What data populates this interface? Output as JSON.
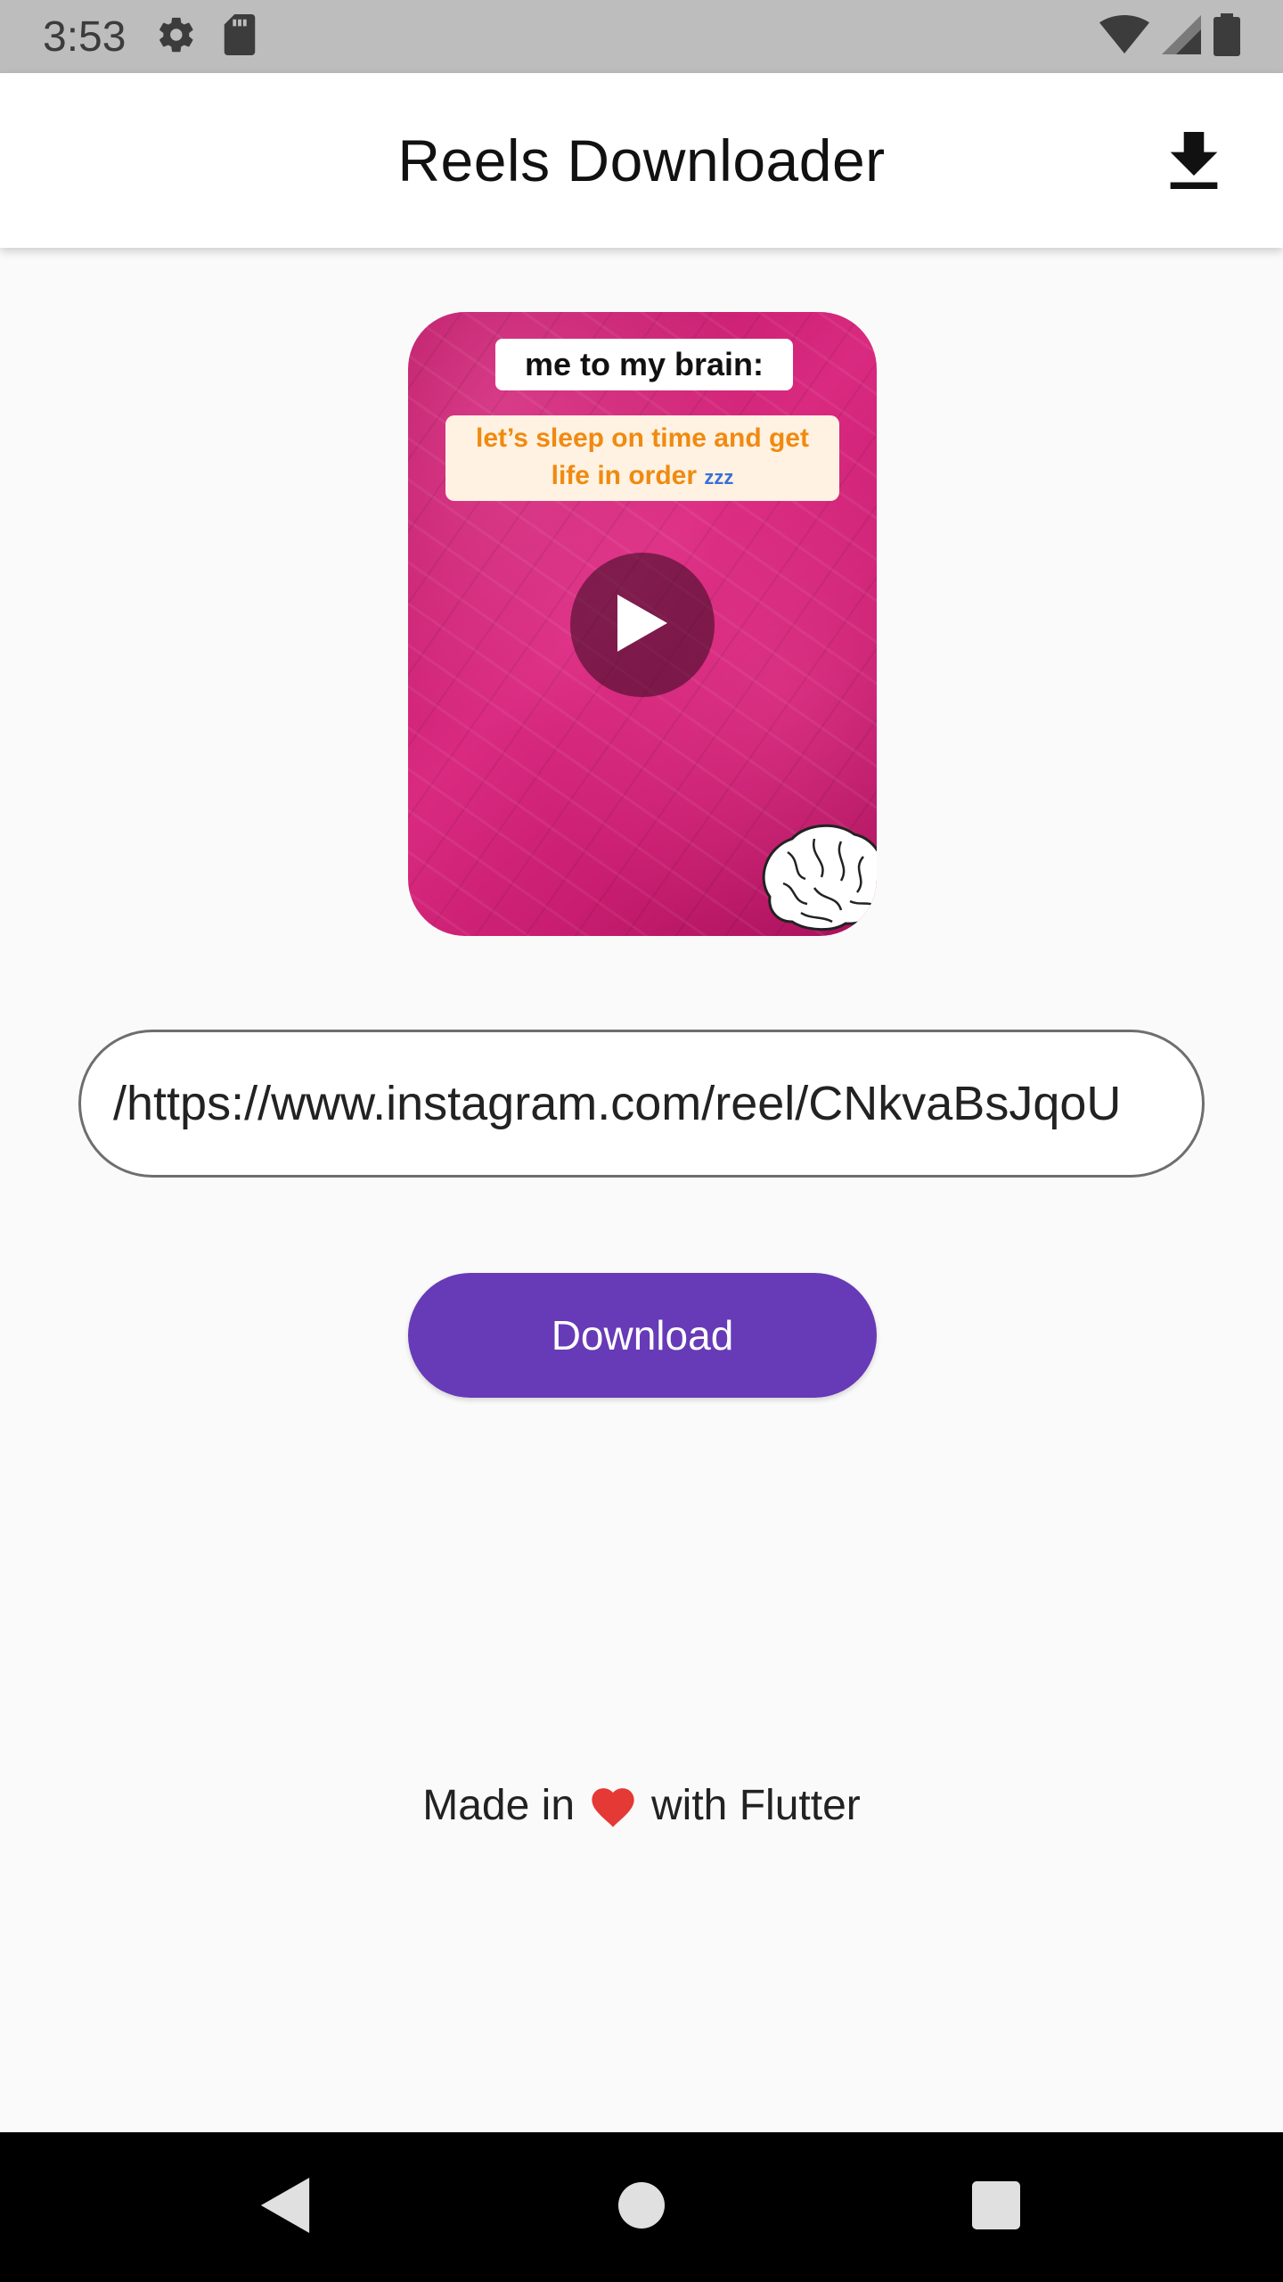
{
  "status_bar": {
    "time": "3:53",
    "icons": [
      "gear-icon",
      "sd-card-icon",
      "wifi-icon",
      "signal-icon",
      "battery-icon"
    ]
  },
  "app_bar": {
    "title": "Reels Downloader",
    "action_icon": "download-icon"
  },
  "preview": {
    "caption_top": "me to my brain:",
    "caption_line1": "let’s sleep on time and get",
    "caption_line2": "life in order",
    "zzz": "zzz",
    "play_icon": "play-icon"
  },
  "url_field": {
    "value": "https://www.instagram.com/reel/CNkvaBsJqoU/"
  },
  "download_button": {
    "label": "Download"
  },
  "footer": {
    "made_in": "Made in",
    "with": "with Flutter",
    "heart_color": "#e53935"
  },
  "colors": {
    "primary": "#673ab7",
    "status_bar": "#bdbdbd",
    "background": "#fafafa"
  },
  "nav_bar": {
    "icons": [
      "back-icon",
      "home-icon",
      "recents-icon"
    ]
  }
}
